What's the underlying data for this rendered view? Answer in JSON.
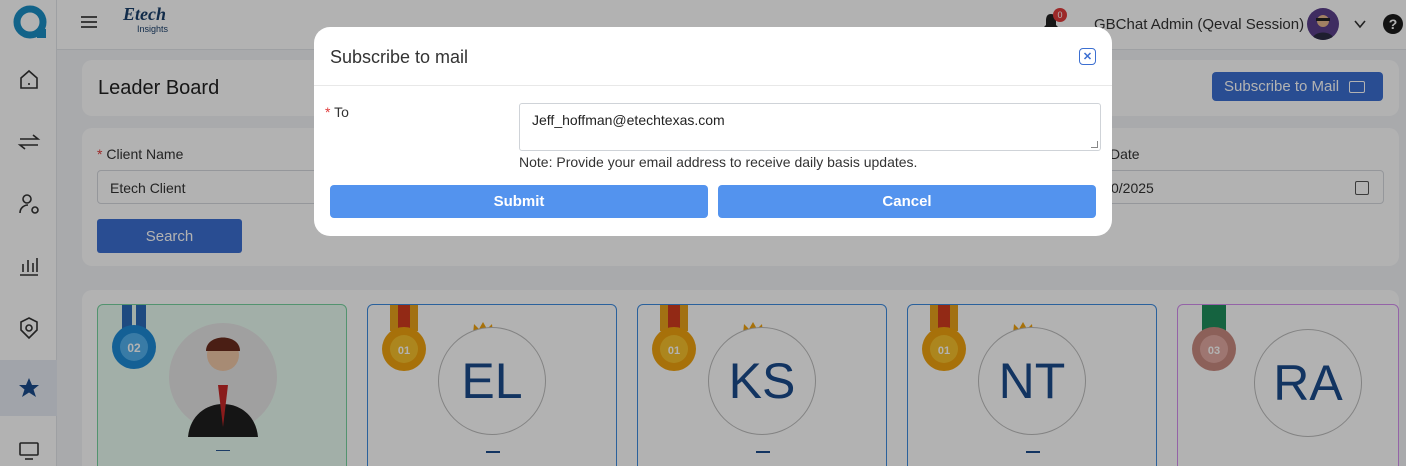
{
  "topbar": {
    "brand_name": "Etech",
    "brand_sub": "Insights",
    "notification_count": "0",
    "user_name": "GBChat Admin (Qeval Session)",
    "help_glyph": "?"
  },
  "sidebar": {
    "items": [
      {
        "icon": "home-icon"
      },
      {
        "icon": "transfer-icon"
      },
      {
        "icon": "user-settings-icon"
      },
      {
        "icon": "bar-chart-icon"
      },
      {
        "icon": "badge-icon"
      },
      {
        "icon": "star-award-icon",
        "active": true
      },
      {
        "icon": "monitor-icon"
      }
    ]
  },
  "page": {
    "title": "Leader Board",
    "subscribe_button": "Subscribe to Mail"
  },
  "filters": {
    "client_label": "Client Name",
    "client_value": "Etech Client",
    "date_label": "Date",
    "date_value": "0/2025",
    "search_button": "Search"
  },
  "cards": [
    {
      "rank": "02",
      "initials": "",
      "style": "green",
      "dash": "—"
    },
    {
      "rank": "01",
      "initials": "EL",
      "style": "blue",
      "dash": "—"
    },
    {
      "rank": "01",
      "initials": "KS",
      "style": "blue",
      "dash": "—"
    },
    {
      "rank": "01",
      "initials": "NT",
      "style": "blue",
      "dash": "—"
    },
    {
      "rank": "03",
      "initials": "RA",
      "style": "pink",
      "dash": ""
    }
  ],
  "modal": {
    "title": "Subscribe to mail",
    "to_label": "To",
    "to_value": "Jeff_hoffman@etechtexas.com",
    "note": "Note: Provide your email address to receive daily basis updates.",
    "submit": "Submit",
    "cancel": "Cancel"
  },
  "colors": {
    "primary": "#3c6fd1",
    "modal_button": "#5393ee",
    "required": "#e03b3b",
    "brand_navy": "#1a4b8c"
  }
}
